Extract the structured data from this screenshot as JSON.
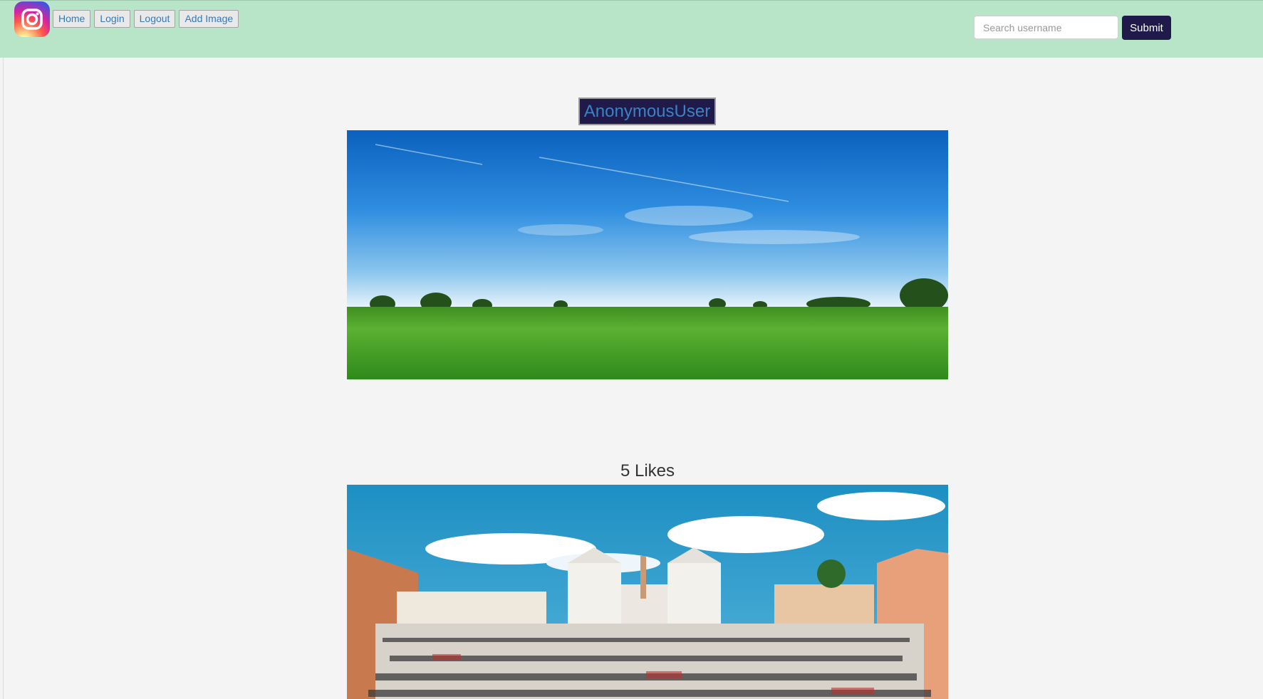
{
  "navbar": {
    "logo": "instagram-logo",
    "buttons": [
      {
        "label": "Home"
      },
      {
        "label": "Login"
      },
      {
        "label": "Logout"
      },
      {
        "label": "Add Image"
      }
    ],
    "search": {
      "placeholder": "Search username",
      "value": ""
    },
    "submit_label": "Submit"
  },
  "posts": [
    {
      "username": "AnonymousUser",
      "image": "green-field-blue-sky-photo"
    },
    {
      "likes": "5 Likes",
      "image": "spanish-steps-rome-crowd-photo"
    }
  ],
  "colors": {
    "navbar_bg": "#b8e4c8",
    "page_bg": "#f4f4f4",
    "accent_dark": "#1f1a4a",
    "link_blue": "#337ab7"
  }
}
